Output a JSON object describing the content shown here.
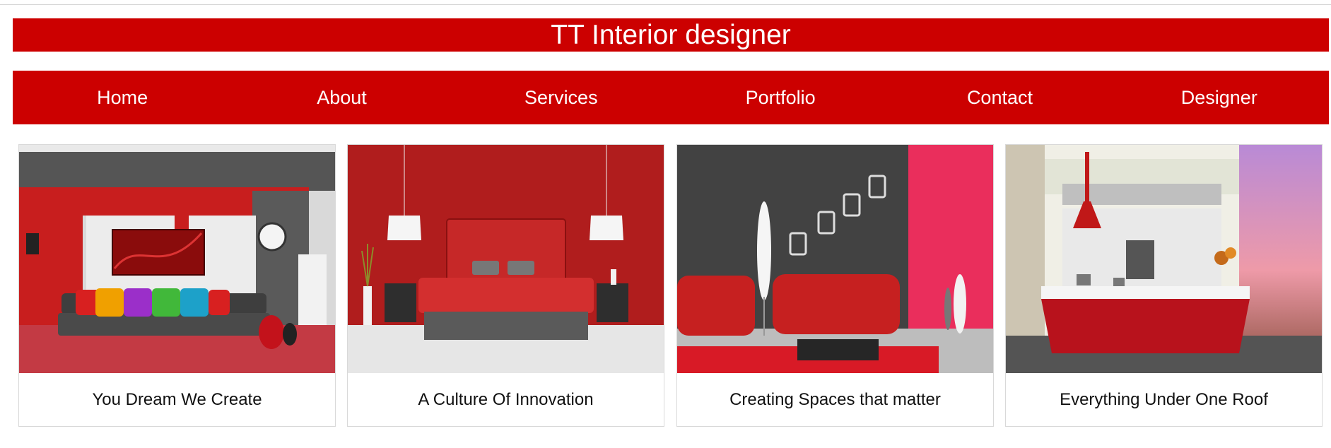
{
  "header": {
    "title": "TT Interior designer"
  },
  "nav": {
    "items": [
      {
        "label": "Home"
      },
      {
        "label": "About"
      },
      {
        "label": "Services"
      },
      {
        "label": "Portfolio"
      },
      {
        "label": "Contact"
      },
      {
        "label": "Designer"
      }
    ]
  },
  "cards": [
    {
      "caption": "You Dream We Create",
      "image": "red-living-room-photo"
    },
    {
      "caption": "A Culture Of Innovation",
      "image": "red-bedroom-photo"
    },
    {
      "caption": "Creating Spaces that matter",
      "image": "red-sofa-lounge-photo"
    },
    {
      "caption": "Everything Under One Roof",
      "image": "red-kitchen-photo"
    }
  ],
  "colors": {
    "brand": "#cc0000",
    "text_on_brand": "#ffffff",
    "caption_text": "#111111"
  }
}
